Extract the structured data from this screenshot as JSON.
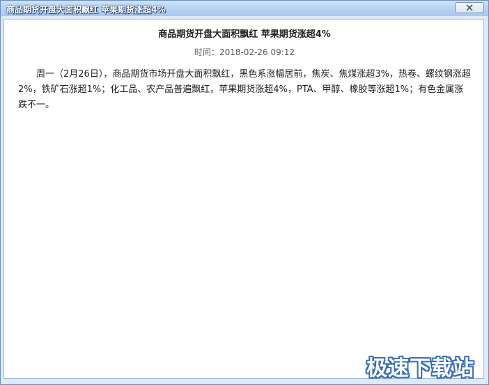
{
  "window": {
    "title": "商品期货开盘大面积飘红 苹果期货涨超4%"
  },
  "article": {
    "title": "商品期货开盘大面积飘红 苹果期货涨超4%",
    "time_label": "时间：",
    "time_value": "2018-02-26 09:12",
    "body": "周一（2月26日），商品期货市场开盘大面积飘红，黑色系涨幅居前，焦炭、焦煤涨超3%，热卷、螺纹钢涨超2%，铁矿石涨超1%；化工品、农产品普遍飘红，苹果期货涨超4%，PTA、甲醇、橡胶等涨超1%；有色金属涨跌不一。"
  },
  "watermark": {
    "text": "极速下载站"
  },
  "icons": {
    "close": "close-icon"
  },
  "colors": {
    "titlebar": "#b8d3f3",
    "window_border": "#6a8fbf",
    "watermark_outline": "#3b6fb6"
  }
}
